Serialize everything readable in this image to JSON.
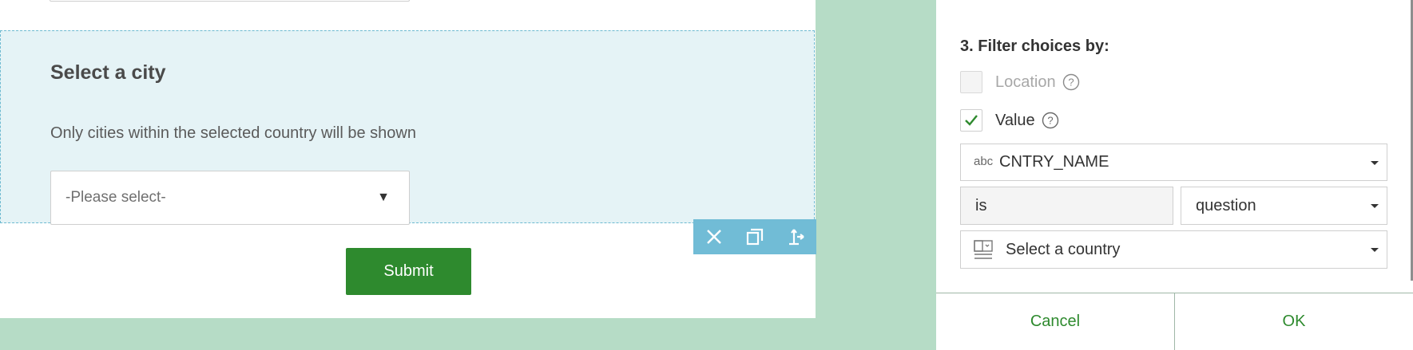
{
  "form": {
    "question": {
      "title": "Select a city",
      "description": "Only cities within the selected country will be shown",
      "select_placeholder": "-Please select-",
      "select_caret": "▼"
    },
    "toolbar": {
      "icons": [
        "close-icon",
        "duplicate-icon",
        "move-icon"
      ]
    },
    "submit_label": "Submit"
  },
  "panel": {
    "section_title": "3. Filter choices by:",
    "options": [
      {
        "label": "Location",
        "checked": false,
        "disabled": true
      },
      {
        "label": "Value",
        "checked": true,
        "disabled": false
      }
    ],
    "field": {
      "type_badge": "abc",
      "value": "CNTRY_NAME"
    },
    "operator": "is",
    "value_type": "question",
    "source_question": "Select a country",
    "buttons": {
      "cancel": "Cancel",
      "ok": "OK"
    }
  },
  "colors": {
    "background": "#b6dcc6",
    "question_highlight": "#e5f3f6",
    "toolbar": "#71bcd6",
    "accent_green": "#2e8a2e"
  }
}
